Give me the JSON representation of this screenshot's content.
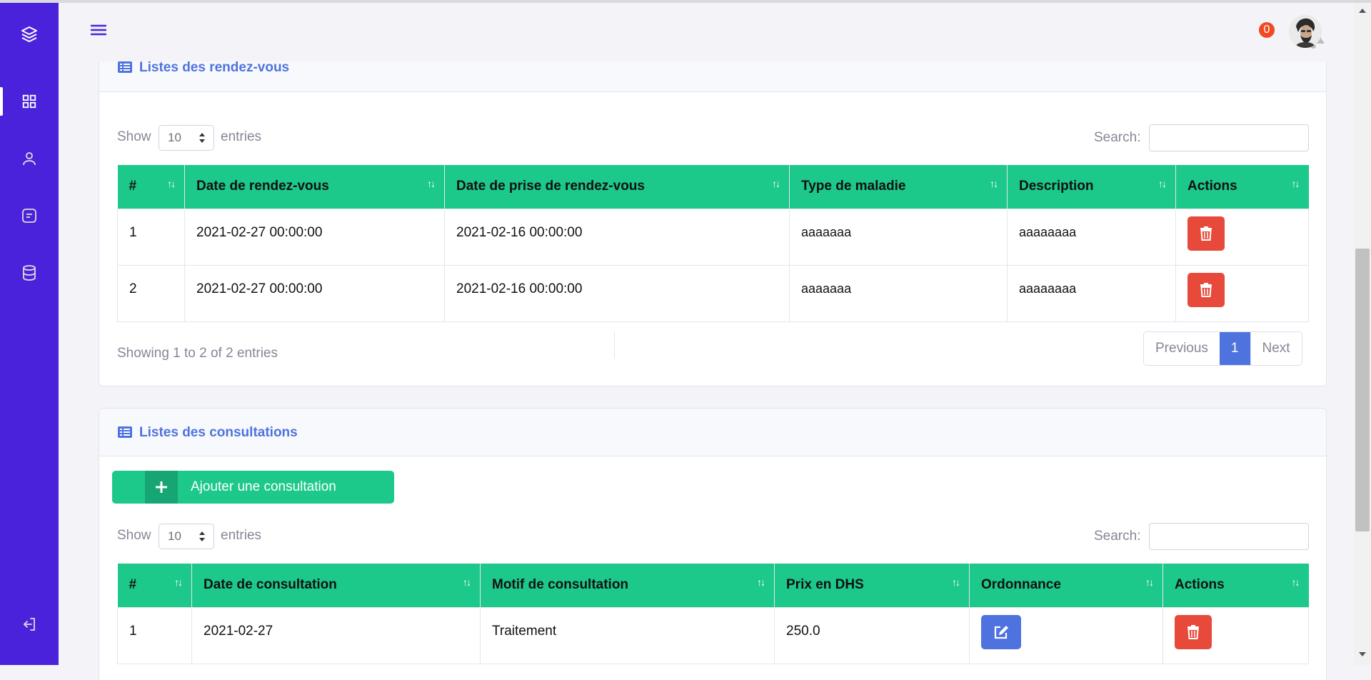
{
  "notifications": {
    "count": "0"
  },
  "appointments": {
    "title": "Listes des rendez-vous",
    "length": {
      "show": "Show",
      "value": "10",
      "entries": "entries"
    },
    "search_label": "Search:",
    "columns": [
      "#",
      "Date de rendez-vous",
      "Date de prise de rendez-vous",
      "Type de maladie",
      "Description",
      "Actions"
    ],
    "rows": [
      {
        "num": "1",
        "date": "2021-02-27 00:00:00",
        "booked": "2021-02-16 00:00:00",
        "type": "aaaaaaa",
        "description": "aaaaaaaa"
      },
      {
        "num": "2",
        "date": "2021-02-27 00:00:00",
        "booked": "2021-02-16 00:00:00",
        "type": "aaaaaaa",
        "description": "aaaaaaaa"
      }
    ],
    "info": "Showing 1 to 2 of 2 entries",
    "pagination": {
      "previous": "Previous",
      "current": "1",
      "next": "Next"
    }
  },
  "consultations": {
    "title": "Listes des consultations",
    "add_label": "Ajouter une consultation",
    "length": {
      "show": "Show",
      "value": "10",
      "entries": "entries"
    },
    "search_label": "Search:",
    "columns": [
      "#",
      "Date de consultation",
      "Motif de consultation",
      "Prix en DHS",
      "Ordonnance",
      "Actions"
    ],
    "rows": [
      {
        "num": "1",
        "date": "2021-02-27",
        "motif": "Traitement",
        "price": "250.0"
      }
    ]
  },
  "colors": {
    "sidebar": "#4a22dc",
    "table_header": "#1cc88a",
    "primary": "#4e73df",
    "danger": "#e74a3b"
  }
}
